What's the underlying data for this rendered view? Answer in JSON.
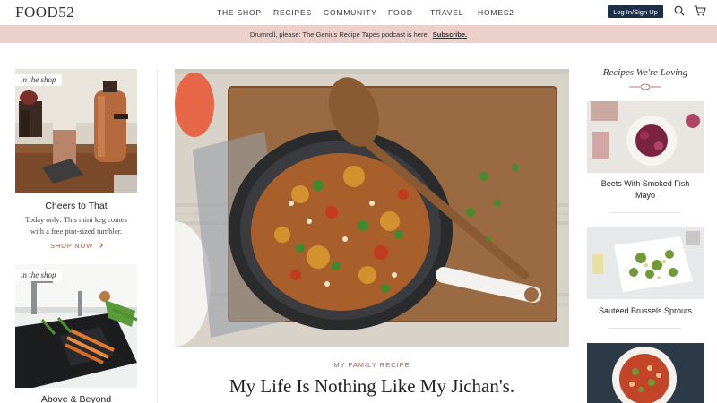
{
  "brand": {
    "logo": "FOOD52"
  },
  "nav": {
    "items": [
      "THE SHOP",
      "RECIPES",
      "COMMUNITY",
      "FOOD",
      "TRAVEL",
      "HOMES2"
    ]
  },
  "header": {
    "login_label": "Log In/Sign Up"
  },
  "banner": {
    "text": "Drumroll, please: The Genius Recipe Tapes podcast is here.",
    "link": "Subscribe."
  },
  "left": {
    "cards": [
      {
        "tag": "in the shop",
        "title": "Cheers to That",
        "desc_line1": "Today only: This mini keg comes",
        "desc_line2": "with a free pint-sized tumbler.",
        "cta": "SHOP NOW"
      },
      {
        "tag": "in the shop",
        "title": "Above & Beyond"
      }
    ]
  },
  "feature": {
    "kicker": "MY FAMILY RECIPE",
    "headline": "My Life Is Nothing Like My Jichan's."
  },
  "right": {
    "title": "Recipes We're Loving",
    "items": [
      {
        "line1": "Beets With Smoked Fish",
        "line2": "Mayo"
      },
      {
        "line1": "Sautéed Brussels Sprouts",
        "line2": ""
      },
      {
        "line1": "",
        "line2": ""
      }
    ]
  },
  "colors": {
    "navy": "#1e3048",
    "banner": "#ebd0cb",
    "accent": "#a0604a"
  }
}
